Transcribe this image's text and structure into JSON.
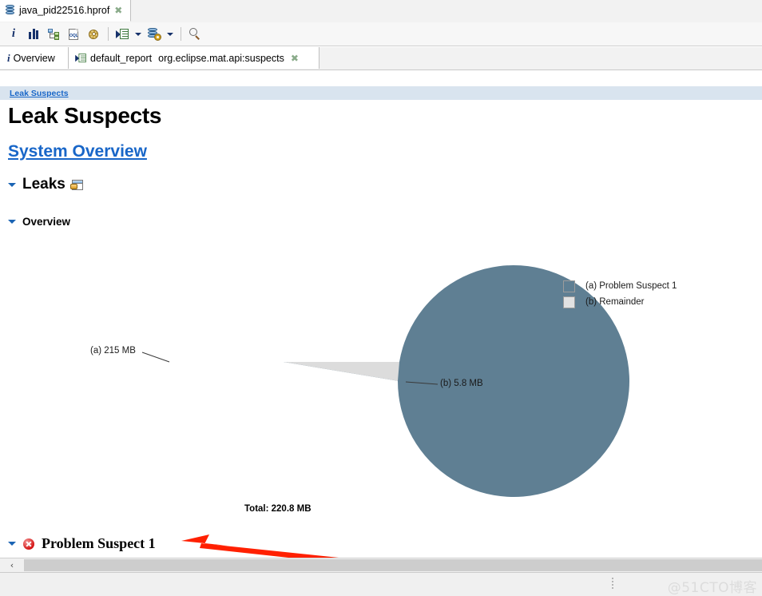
{
  "window": {
    "editor_tab": {
      "title": "java_pid22516.hprof",
      "icon": "heap-dump-icon",
      "close_label": "✖"
    }
  },
  "toolbar": {
    "buttons": [
      {
        "name": "overview-info-button",
        "icon": "info-icon",
        "tooltip": "Overview"
      },
      {
        "name": "histogram-button",
        "icon": "histogram-icon",
        "tooltip": "Histogram"
      },
      {
        "name": "dominator-tree-button",
        "icon": "dominator-tree-icon",
        "tooltip": "Dominator Tree"
      },
      {
        "name": "oql-button",
        "icon": "oql-page-icon",
        "tooltip": "OQL Studio"
      },
      {
        "name": "calculate-button",
        "icon": "gear-icon",
        "tooltip": "Calculate"
      },
      {
        "name": "run-report-button",
        "icon": "run-report-icon",
        "tooltip": "Run Expert System Test"
      },
      {
        "name": "run-report-dropdown",
        "icon": "chevron-down-icon",
        "tooltip": "Run Expert System Test menu"
      },
      {
        "name": "heap-query-button",
        "icon": "heap-gear-icon",
        "tooltip": "Query Browser"
      },
      {
        "name": "heap-query-dropdown",
        "icon": "chevron-down-icon",
        "tooltip": "Query Browser menu"
      },
      {
        "name": "search-button",
        "icon": "search-icon",
        "tooltip": "Find"
      }
    ]
  },
  "view_tabs": [
    {
      "name": "tab-overview",
      "label": "Overview",
      "icon": "info-icon",
      "closable": false
    },
    {
      "name": "tab-default-report",
      "label": "default_report",
      "icon": "run-report-icon",
      "closable": false
    },
    {
      "name": "tab-suspects",
      "label": "org.eclipse.mat.api:suspects",
      "icon": "",
      "closable": true,
      "close_label": "✖"
    }
  ],
  "report": {
    "breadcrumb": "Leak Suspects",
    "page_title": "Leak Suspects",
    "system_overview_link": "System Overview",
    "sections": {
      "leaks": {
        "label": "Leaks",
        "icon": "export-report-icon",
        "expanded": true
      },
      "overview": {
        "label": "Overview",
        "expanded": true
      },
      "problem_suspect": {
        "label": "Problem Suspect 1",
        "icon": "error-icon",
        "expanded": true
      }
    }
  },
  "chart_data": {
    "type": "pie",
    "title": "",
    "total_label": "Total: 220.8 MB",
    "total_value": 220.8,
    "unit": "MB",
    "labels": [
      "(a)  Problem Suspect 1",
      "(b)  Remainder"
    ],
    "categories": [
      "(a)",
      "(b)"
    ],
    "values": [
      215,
      5.8
    ],
    "callouts": [
      "(a)  215 MB",
      "(b)  5.8 MB"
    ],
    "colors": [
      "#5F7F93",
      "#DCDCDC"
    ],
    "legend": [
      {
        "key": "(a)",
        "label": "(a)  Problem Suspect 1",
        "color": "#5F7F93"
      },
      {
        "key": "(b)",
        "label": "(b)  Remainder",
        "color": "#DCDCDC"
      }
    ],
    "legend_position": "right",
    "grid": false
  },
  "annotation": {
    "arrow_color": "#FF2000",
    "points_to": "Problem Suspect 1"
  },
  "scrollbar": {
    "left_arrow": "‹"
  },
  "statusbar": {
    "watermark": "@51CTO博客"
  }
}
